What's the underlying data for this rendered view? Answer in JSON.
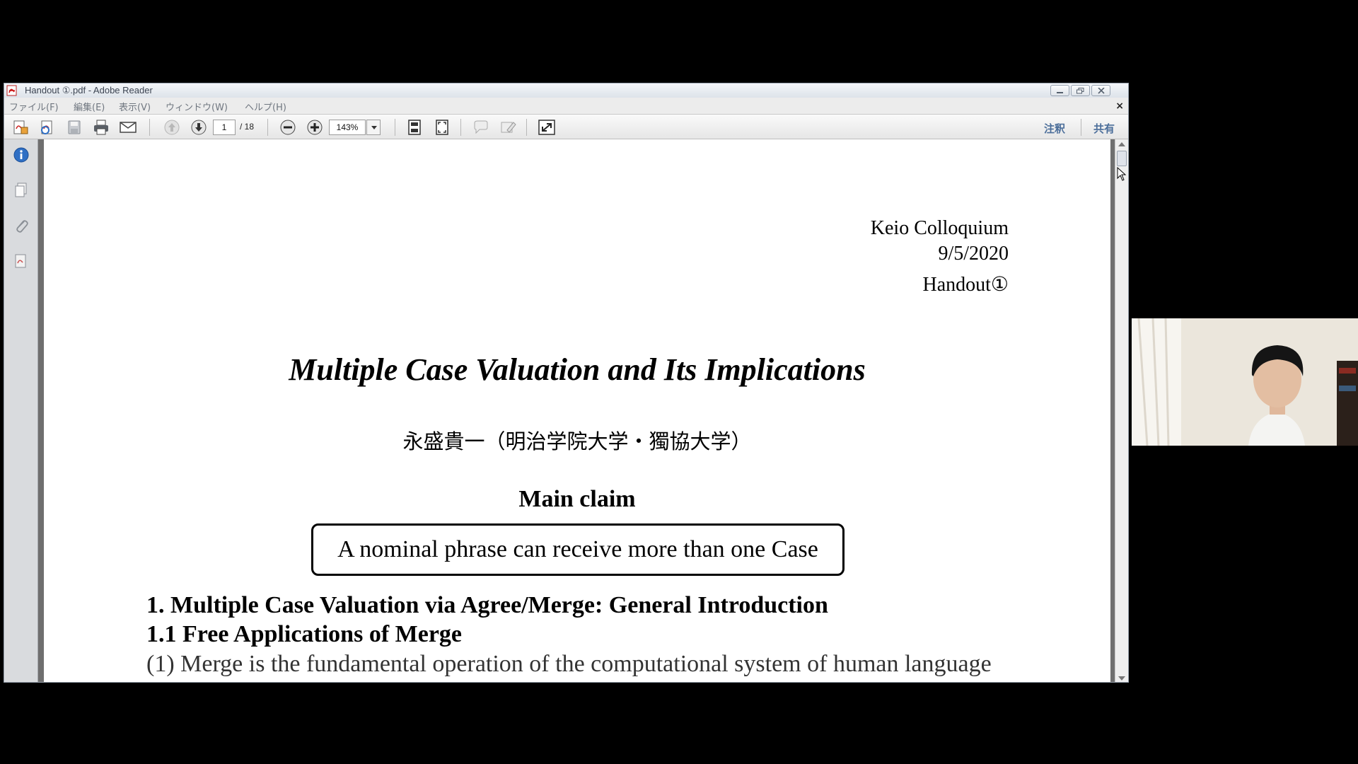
{
  "window": {
    "title": "Handout ①.pdf - Adobe Reader",
    "menu": [
      "ファイル(F)",
      "編集(E)",
      "表示(V)",
      "ウィンドウ(W)",
      "ヘルプ(H)"
    ],
    "close_doc_glyph": "×"
  },
  "toolbar": {
    "page_current": "1",
    "page_total": "/ 18",
    "zoom": "143%",
    "comment_label": "注釈",
    "share_label": "共有"
  },
  "document": {
    "header_lines": [
      "Keio  Colloquium",
      "9/5/2020",
      "Handout①"
    ],
    "title": "Multiple Case Valuation and Its Implications",
    "author": "永盛貴一（明治学院大学・獨協大学）",
    "main_claim_heading": "Main claim",
    "main_claim": "A nominal phrase can receive more than one Case",
    "section_1": "1. Multiple Case Valuation via Agree/Merge: General Introduction",
    "section_1_1": "1.1 Free Applications of Merge",
    "paragraph_1": "(1) Merge is the fundamental operation of the computational system of human language"
  },
  "colors": {
    "accent_blue": "#2f6fc4",
    "link_blue": "#4b6e9a"
  }
}
